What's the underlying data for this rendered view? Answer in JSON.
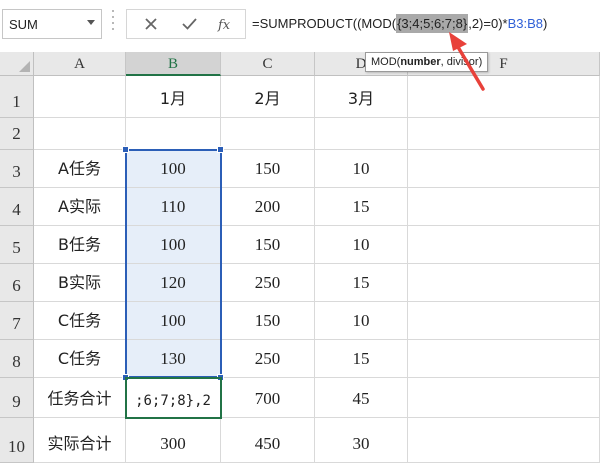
{
  "name_box": {
    "value": "SUM"
  },
  "formula_bar": {
    "prefix": "=SUMPRODUCT((MOD(",
    "highlight": "{3;4;5;6;7;8}",
    "middle": ",2)=0)*",
    "ref": "B3:B8",
    "suffix": ")"
  },
  "tooltip": {
    "fn": "MOD(",
    "arg1": "number",
    "rest": ", divisor)"
  },
  "columns": [
    "A",
    "B",
    "C",
    "D",
    "F"
  ],
  "rows": [
    {
      "num": "1",
      "cells": [
        "",
        "1月",
        "2月",
        "3月",
        ""
      ]
    },
    {
      "num": "2",
      "cells": [
        "",
        "",
        "",
        "",
        ""
      ]
    },
    {
      "num": "3",
      "cells": [
        "A任务",
        "100",
        "150",
        "10",
        ""
      ]
    },
    {
      "num": "4",
      "cells": [
        "A实际",
        "110",
        "200",
        "15",
        ""
      ]
    },
    {
      "num": "5",
      "cells": [
        "B任务",
        "100",
        "150",
        "10",
        ""
      ]
    },
    {
      "num": "6",
      "cells": [
        "B实际",
        "120",
        "250",
        "15",
        ""
      ]
    },
    {
      "num": "7",
      "cells": [
        "C任务",
        "100",
        "150",
        "10",
        ""
      ]
    },
    {
      "num": "8",
      "cells": [
        "C任务",
        "130",
        "250",
        "15",
        ""
      ]
    },
    {
      "num": "9",
      "cells": [
        "任务合计",
        ";6;7;8},2",
        "700",
        "45",
        ""
      ]
    },
    {
      "num": "10",
      "cells": [
        "实际合计",
        "300",
        "450",
        "30",
        ""
      ]
    }
  ],
  "colors": {
    "selection": "#2b5eb7",
    "active": "#217346",
    "arrow": "#e8413a",
    "range_fill": "#e6eef9"
  }
}
